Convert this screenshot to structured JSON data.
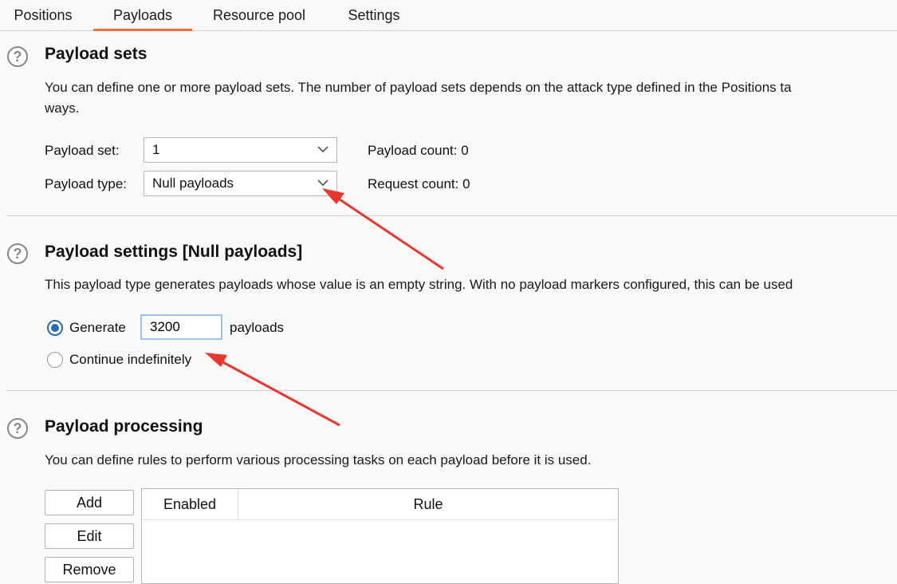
{
  "tabs": [
    {
      "label": "Positions",
      "active": false
    },
    {
      "label": "Payloads",
      "active": true
    },
    {
      "label": "Resource pool",
      "active": false
    },
    {
      "label": "Settings",
      "active": false
    }
  ],
  "help_icon_glyph": "?",
  "payload_sets": {
    "title": "Payload sets",
    "desc_line1": "You can define one or more payload sets. The number of payload sets depends on the attack type defined in the Positions ta",
    "desc_line2": "ways.",
    "set_label": "Payload set:",
    "set_value": "1",
    "type_label": "Payload type:",
    "type_value": "Null payloads",
    "payload_count": "Payload count: 0",
    "request_count": "Request count: 0"
  },
  "payload_settings": {
    "title": "Payload settings [Null payloads]",
    "desc": "This payload type generates payloads whose value is an empty string. With no payload markers configured, this can be used",
    "generate_label": "Generate",
    "generate_value": "3200",
    "payloads_suffix": "payloads",
    "continue_label": "Continue indefinitely",
    "selected_option": "Generate"
  },
  "payload_processing": {
    "title": "Payload processing",
    "desc": "You can define rules to perform various processing tasks on each payload before it is used.",
    "buttons": {
      "add": "Add",
      "edit": "Edit",
      "remove": "Remove"
    },
    "columns": {
      "enabled": "Enabled",
      "rule": "Rule"
    }
  },
  "annotation_color": "#e8372f",
  "accent_color": "#e8703a",
  "radio_color": "#2b6cb0"
}
